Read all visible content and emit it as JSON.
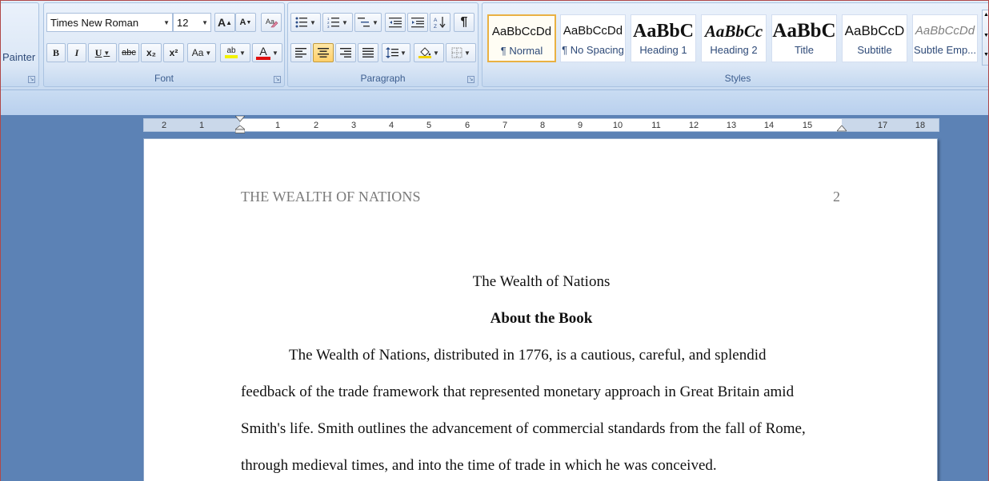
{
  "clipboard": {
    "painter_label": "Painter"
  },
  "font": {
    "group_label": "Font",
    "name": "Times New Roman",
    "size": "12",
    "bold": "B",
    "italic": "I",
    "underline": "U",
    "strike": "abc",
    "sub": "x₂",
    "sup": "x²",
    "case": "Aa",
    "grow": "A",
    "shrink": "A",
    "color_glyph": "A",
    "highlight_glyph": "ab"
  },
  "paragraph": {
    "group_label": "Paragraph",
    "pilcrow": "¶"
  },
  "styles": {
    "group_label": "Styles",
    "items": [
      {
        "sample": "AaBbCcDd",
        "name": "¶ Normal"
      },
      {
        "sample": "AaBbCcDd",
        "name": "¶ No Spacing"
      },
      {
        "sample": "AaBbC",
        "name": "Heading 1"
      },
      {
        "sample": "AaBbCc",
        "name": "Heading 2"
      },
      {
        "sample": "AaBbC",
        "name": "Title"
      },
      {
        "sample": "AaBbCcD",
        "name": "Subtitle"
      },
      {
        "sample": "AaBbCcDd",
        "name": "Subtle Emp..."
      }
    ]
  },
  "ruler": {
    "left_labels": [
      "2",
      "1"
    ],
    "right_labels": [
      "1",
      "2",
      "3",
      "4",
      "5",
      "6",
      "7",
      "8",
      "9",
      "10",
      "11",
      "12",
      "13",
      "14",
      "15",
      "17",
      "18"
    ]
  },
  "document": {
    "header_title": "THE WEALTH OF NATIONS",
    "header_page": "2",
    "title": "The Wealth of Nations",
    "heading": "About the Book",
    "lines": [
      "The Wealth of Nations, distributed in 1776, is a cautious, careful, and splendid",
      "feedback of the trade framework that represented monetary approach in Great Britain amid",
      "Smith's life. Smith outlines the advancement of commercial standards from the fall of Rome,",
      "through medieval times, and into the time of trade in which he was conceived."
    ]
  }
}
